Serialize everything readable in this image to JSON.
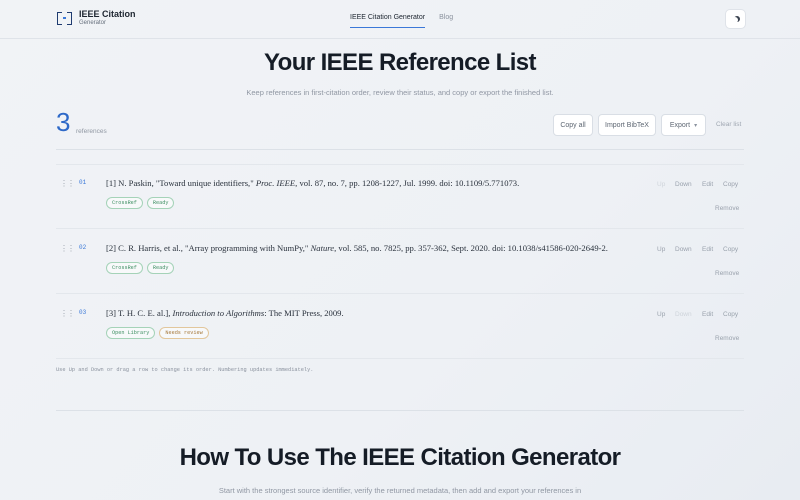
{
  "brand": {
    "title": "IEEE Citation",
    "subtitle": "Generator"
  },
  "nav": [
    {
      "label": "IEEE Citation Generator",
      "active": true
    },
    {
      "label": "Blog",
      "active": false
    }
  ],
  "theme_toggle": {
    "icon": "moon-icon"
  },
  "hero": {
    "title": "Your IEEE Reference List",
    "subtitle": "Keep references in first-citation order, review their status, and copy or export the finished list."
  },
  "summary": {
    "count": "3",
    "count_label": "references"
  },
  "toolbar": {
    "copy_all": "Copy all",
    "import_bibtex": "Import BibTeX",
    "export": "Export",
    "export_caret": "▾",
    "clear": "Clear list"
  },
  "references": [
    {
      "num": "01",
      "prefix": "[1] N. Paskin, \"Toward unique identifiers,\" ",
      "italic": "Proc. IEEE",
      "suffix": ", vol. 87, no. 7, pp. 1208-1227, Jul. 1999. doi: 10.1109/5.771073.",
      "badges": [
        {
          "label": "CrossRef",
          "tone": "green"
        },
        {
          "label": "Ready",
          "tone": "green"
        }
      ],
      "actions": {
        "up": "Up",
        "up_enabled": false,
        "down": "Down",
        "down_enabled": true,
        "edit": "Edit",
        "copy": "Copy",
        "remove": "Remove"
      }
    },
    {
      "num": "02",
      "prefix": "[2] C. R. Harris, et al., \"Array programming with NumPy,\" ",
      "italic": "Nature",
      "suffix": ", vol. 585, no. 7825, pp. 357-362, Sept. 2020. doi: 10.1038/s41586-020-2649-2.",
      "badges": [
        {
          "label": "CrossRef",
          "tone": "green"
        },
        {
          "label": "Ready",
          "tone": "green"
        }
      ],
      "actions": {
        "up": "Up",
        "up_enabled": true,
        "down": "Down",
        "down_enabled": true,
        "edit": "Edit",
        "copy": "Copy",
        "remove": "Remove"
      }
    },
    {
      "num": "03",
      "prefix": "[3] T. H. C. E. al.], ",
      "italic": "Introduction to Algorithms",
      "suffix": ": The MIT Press, 2009.",
      "badges": [
        {
          "label": "Open Library",
          "tone": "green"
        },
        {
          "label": "Needs review",
          "tone": "warn"
        }
      ],
      "actions": {
        "up": "Up",
        "up_enabled": true,
        "down": "Down",
        "down_enabled": false,
        "edit": "Edit",
        "copy": "Copy",
        "remove": "Remove"
      }
    }
  ],
  "hint": "Use Up and Down or drag a row to change its order. Numbering updates immediately.",
  "howto": {
    "title": "How To Use The IEEE Citation Generator",
    "subtitle": "Start with the strongest source identifier, verify the returned metadata, then add and export your references in"
  },
  "colors": {
    "accent": "#2e69c8",
    "badge_green": "#3e8f62",
    "badge_warn": "#a57738"
  }
}
